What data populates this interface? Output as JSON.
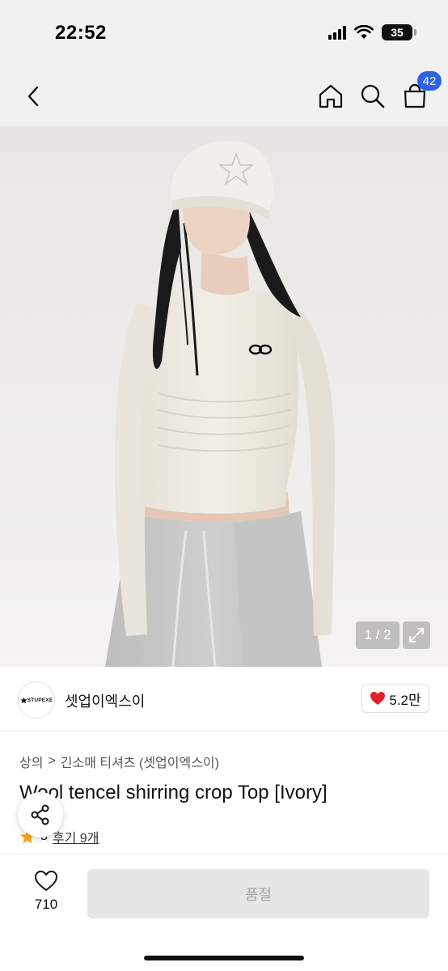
{
  "status_bar": {
    "time": "22:52",
    "battery": "35"
  },
  "nav": {
    "cart_count": "42"
  },
  "gallery": {
    "counter": "1 / 2"
  },
  "brand": {
    "logo_text": "STUPEXE",
    "name": "셋업이엑스이",
    "likes": "5.2만"
  },
  "breadcrumb": {
    "category": "상의",
    "separator": ">",
    "subcategory": "긴소매 티셔츠 (셋업이엑스이)"
  },
  "product": {
    "title": "Wool tencel shirring crop Top [Ivory]",
    "rating": "5",
    "reviews": "후기 9개"
  },
  "bottom_bar": {
    "wish_count": "710",
    "buy_label": "품절"
  },
  "colors": {
    "accent": "#2e63e6",
    "heart": "#e0202b",
    "star": "#f5a623"
  },
  "icons": [
    "back-chevron-icon",
    "home-icon",
    "search-icon",
    "cart-icon",
    "expand-icon",
    "heart-icon",
    "share-icon",
    "star-icon"
  ]
}
